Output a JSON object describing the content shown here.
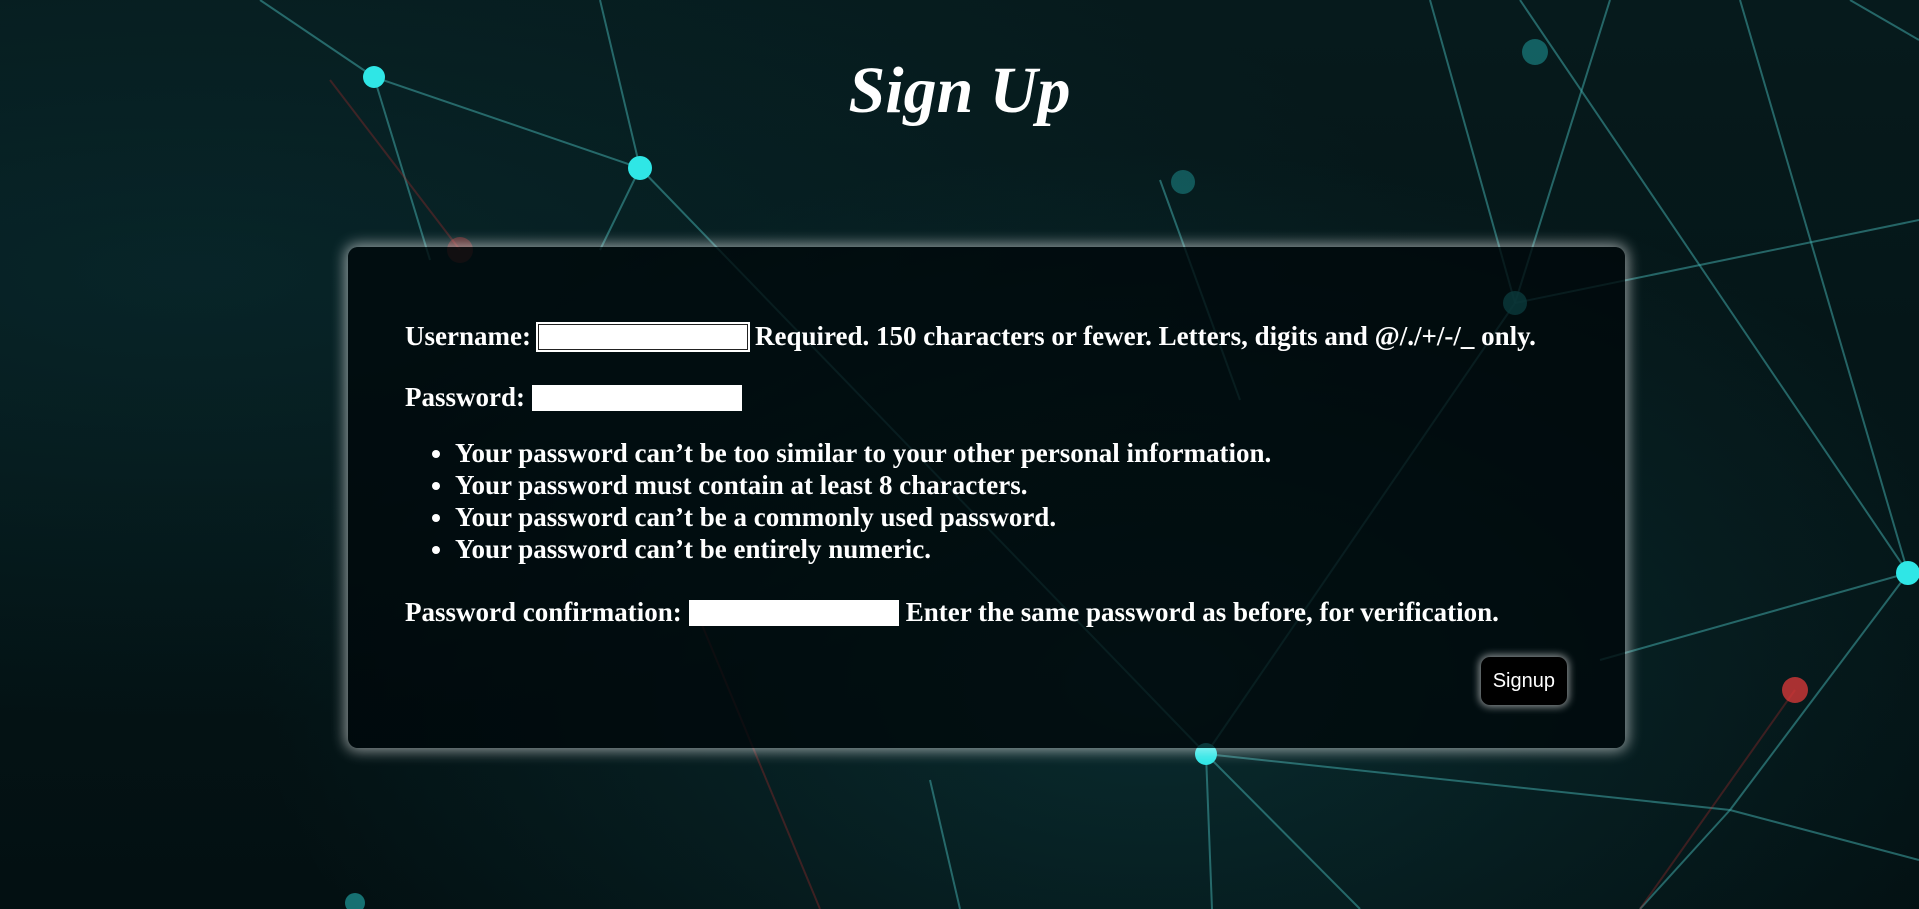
{
  "page": {
    "title": "Sign Up",
    "accent_color": "#2fe6e6",
    "background_color": "#041416"
  },
  "form": {
    "username": {
      "label": "Username:",
      "value": "",
      "help_text": "Required. 150 characters or fewer. Letters, digits and @/./+/-/_ only."
    },
    "password": {
      "label": "Password:",
      "value": "",
      "rules": [
        "Your password can’t be too similar to your other personal information.",
        "Your password must contain at least 8 characters.",
        "Your password can’t be a commonly used password.",
        "Your password can’t be entirely numeric."
      ]
    },
    "password_confirmation": {
      "label": "Password confirmation:",
      "value": "",
      "help_text": "Enter the same password as before, for verification."
    },
    "submit_label": "Signup"
  }
}
